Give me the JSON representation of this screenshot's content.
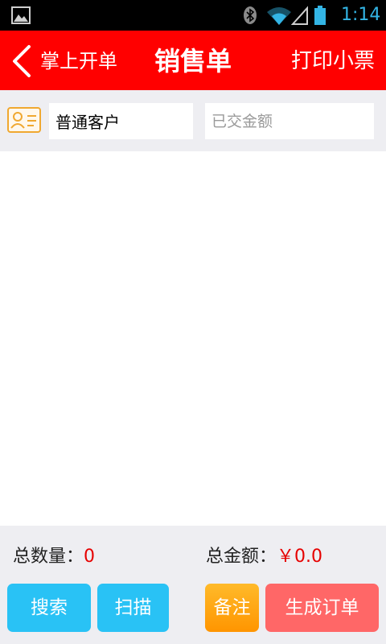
{
  "status_bar": {
    "time": "1:14",
    "icons": [
      "gallery-icon",
      "bluetooth-icon",
      "wifi-icon",
      "signal-icon",
      "battery-icon"
    ]
  },
  "header": {
    "back_label": "掌上开单",
    "title": "销售单",
    "print_label": "打印小票",
    "background": "#ff0000"
  },
  "customer": {
    "icon": "contact-card-icon",
    "name_value": "普通客户",
    "paid_placeholder": "已交金额"
  },
  "footer": {
    "total_qty_label": "总数量：",
    "total_qty_value": "0",
    "total_amount_label": "总金额：",
    "total_amount_value": "￥0.0",
    "buttons": {
      "search": "搜索",
      "scan": "扫描",
      "note": "备注",
      "create_order": "生成订单"
    }
  },
  "colors": {
    "accent_red": "#ff0000",
    "button_blue": "#29c2f5",
    "button_orange": "#ff9500",
    "button_pink": "#ff6767",
    "value_red": "#e60000"
  }
}
